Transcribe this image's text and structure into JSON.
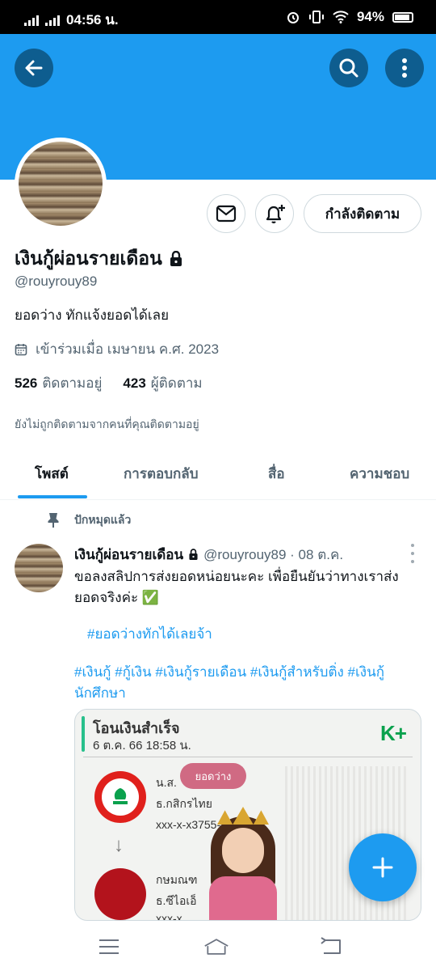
{
  "status_bar": {
    "time": "04:56 น.",
    "battery": "94%"
  },
  "header": {
    "back_icon": "arrow-left-icon",
    "search_icon": "search-icon",
    "more_icon": "more-vertical-icon",
    "banner_color": "#1d9bf0"
  },
  "profile": {
    "name": "เงินกู้ผ่อนรายเดือน",
    "handle": "@rouyrouy89",
    "bio": "ยอดว่าง ทักแจ้งยอดได้เลย",
    "joined": "เข้าร่วมเมื่อ เมษายน ค.ศ. 2023",
    "following_count": "526",
    "following_label": "ติดตามอยู่",
    "followers_count": "423",
    "followers_label": "ผู้ติดตาม",
    "not_followed_note": "ยังไม่ถูกติดตามจากคนที่คุณติดตามอยู่",
    "follow_button": "กำลังติดตาม"
  },
  "tabs": [
    {
      "label": "โพสต์",
      "active": true
    },
    {
      "label": "การตอบกลับ",
      "active": false
    },
    {
      "label": "สื่อ",
      "active": false
    },
    {
      "label": "ความชอบ",
      "active": false
    }
  ],
  "post": {
    "pinned_label": "ปักหมุดแล้ว",
    "author": "เงินกู้ผ่อนรายเดือน",
    "handle_date": "@rouyrouy89 · 08 ต.ค.",
    "text": "ขอลงสลิปการส่งยอดหน่อยนะคะ เพื่อยืนยันว่าทางเราส่งยอดจริงค่ะ ✅",
    "hashtag_line": "#ยอดว่างทักได้เลยจ้า",
    "hashtags": "#เงินกู้ #กู้เงิน #เงินกู้รายเดือน #เงินกู้สำหรับติ่ง #เงินกู้นักศึกษา",
    "media": {
      "title": "โอนเงินสำเร็จ",
      "date": "6 ต.ค. 66  18:58 น.",
      "logo": "K+",
      "sender_name": "น.ส.",
      "sender_bank": "ธ.กสิกรไทย",
      "sender_account": "xxx-x-x3755-x",
      "badge": "ยอดว่าง",
      "receiver_name": "กษมณฑ",
      "receiver_bank": "ธ.ซีไอเอ็",
      "receiver_account": "xxx-x"
    }
  },
  "fab": {
    "icon": "plus-icon"
  },
  "nav": {
    "menu_icon": "menu-icon",
    "home_icon": "home-icon",
    "back_icon": "back-icon"
  }
}
